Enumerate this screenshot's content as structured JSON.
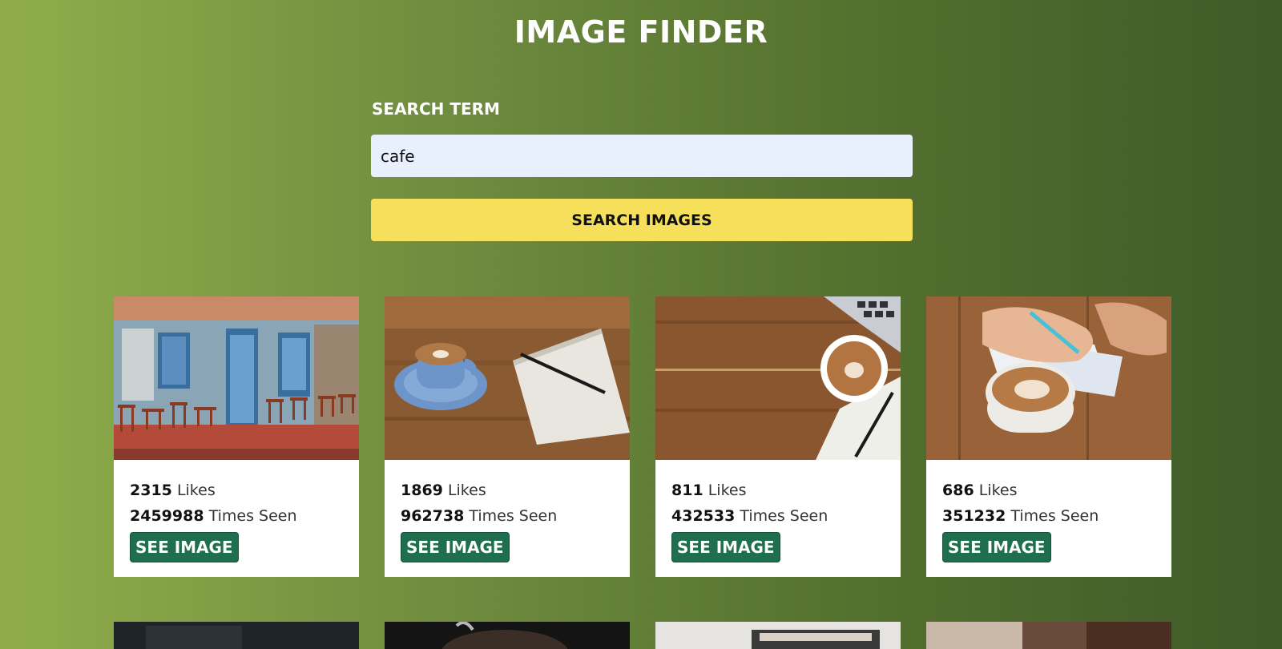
{
  "header": {
    "title": "IMAGE FINDER"
  },
  "search": {
    "label": "SEARCH TERM",
    "value": "cafe",
    "button_label": "SEARCH IMAGES"
  },
  "cards": [
    {
      "likes": "2315",
      "likes_label": "Likes",
      "views": "2459988",
      "views_label": "Times Seen",
      "button_label": "SEE IMAGE",
      "photo": "cafe-storefront"
    },
    {
      "likes": "1869",
      "likes_label": "Likes",
      "views": "962738",
      "views_label": "Times Seen",
      "button_label": "SEE IMAGE",
      "photo": "coffee-cup-notebook"
    },
    {
      "likes": "811",
      "likes_label": "Likes",
      "views": "432533",
      "views_label": "Times Seen",
      "button_label": "SEE IMAGE",
      "photo": "latte-laptop-table"
    },
    {
      "likes": "686",
      "likes_label": "Likes",
      "views": "351232",
      "views_label": "Times Seen",
      "button_label": "SEE IMAGE",
      "photo": "hand-writing-cappuccino"
    }
  ],
  "colors": {
    "accent_yellow": "#f5df5b",
    "button_green": "#1f6e4f",
    "input_bg": "#e8f0fe"
  }
}
